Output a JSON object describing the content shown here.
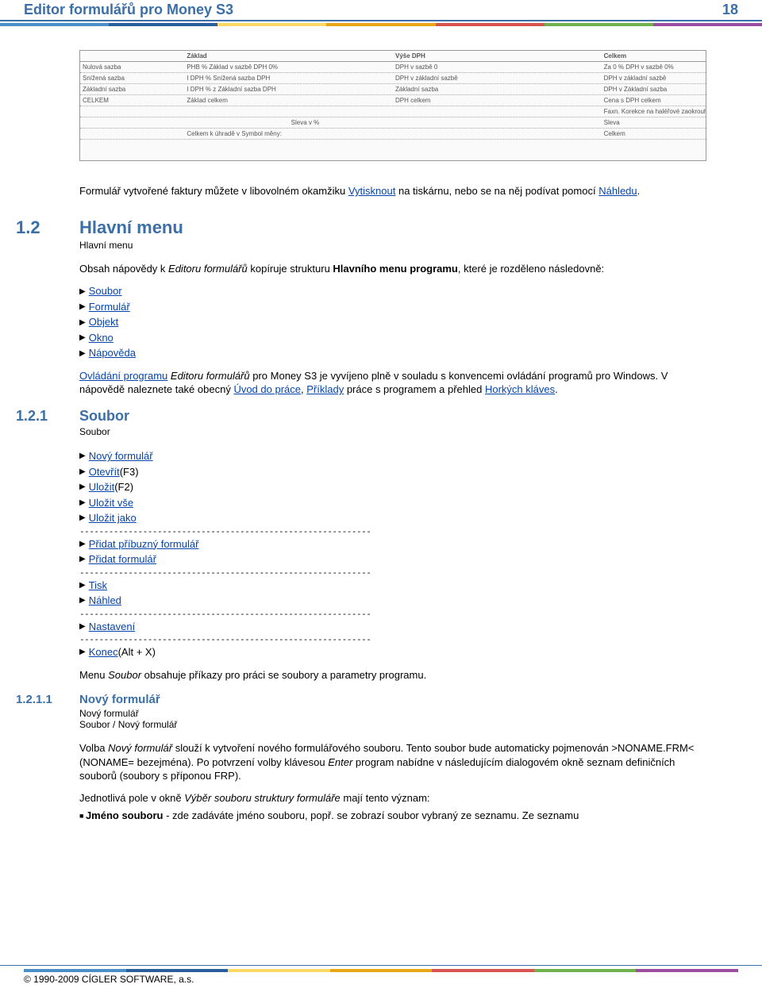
{
  "header": {
    "title": "Editor formulářů pro Money S3",
    "page": "18"
  },
  "screenshot": {
    "head": [
      "",
      "Základ",
      "",
      "Výše DPH",
      "",
      "Celkem"
    ],
    "rows": [
      [
        "Nulová sazba",
        "PHB % Základ v sazbě DPH 0%",
        "",
        "DPH v sazbě 0",
        "",
        "Za 0 % DPH v sazbě 0%"
      ],
      [
        "Snížená sazba",
        "I DPH % Snížená sazba DPH",
        "",
        "DPH v základní sazbě",
        "",
        "DPH v základní sazbě"
      ],
      [
        "Základní sazba",
        "I DPH % z Základní sazba DPH",
        "",
        "Základní sazba",
        "",
        "DPH v Základní sazba"
      ],
      [
        "CELKEM",
        "Základ celkem",
        "",
        "DPH celkem",
        "",
        "Cena s DPH celkem"
      ],
      [
        "",
        "",
        "",
        "",
        "",
        "Faxn. Korekce na haléřové zaokrouh."
      ],
      [
        "",
        "",
        "Sleva v %",
        "",
        "",
        "Sleva"
      ],
      [
        "",
        "Celkem k úhradě v Symbol měny:",
        "",
        "",
        "",
        "Celkem"
      ]
    ]
  },
  "intro": {
    "pre": "Formulář vytvořené faktury můžete v libovolném okamžiku ",
    "link1": "Vytisknout",
    "mid": " na tiskárnu, nebo se na něj podívat pomocí ",
    "link2": "Náhledu",
    "post": "."
  },
  "s12": {
    "num": "1.2",
    "title": "Hlavní menu",
    "sub": "Hlavní menu",
    "para": {
      "t1": "Obsah nápovědy k ",
      "it1": "Editoru formulářů",
      "t2": " kopíruje strukturu ",
      "b1": "Hlavního menu programu",
      "t3": ", které je rozděleno následovně:"
    },
    "items": [
      {
        "label": "Soubor"
      },
      {
        "label": "Formulář"
      },
      {
        "label": "Objekt"
      },
      {
        "label": "Okno"
      },
      {
        "label": "Nápověda"
      }
    ],
    "para2": {
      "l1": "Ovládání programu",
      "t1": " ",
      "it1": "Editoru formulářů",
      "t2": " pro Money S3 je vyvíjeno plně v souladu s konvencemi ovládání programů pro Windows. V nápovědě naleznete také obecný ",
      "l2": "Úvod do práce",
      "t3": ", ",
      "l3": "Příklady",
      "t4": " práce s programem a přehled ",
      "l4": "Horkých kláves",
      "t5": "."
    }
  },
  "s121": {
    "num": "1.2.1",
    "title": "Soubor",
    "sub": "Soubor",
    "items": [
      {
        "type": "item",
        "label": "Nový formulář",
        "suffix": ""
      },
      {
        "type": "item",
        "label": "Otevřít",
        "suffix": " (F3)"
      },
      {
        "type": "item",
        "label": "Uložit",
        "suffix": " (F2)"
      },
      {
        "type": "item",
        "label": "Uložit vše",
        "suffix": ""
      },
      {
        "type": "item",
        "label": "Uložit jako",
        "suffix": ""
      },
      {
        "type": "sep"
      },
      {
        "type": "item",
        "label": "Přidat příbuzný formulář",
        "suffix": ""
      },
      {
        "type": "item",
        "label": "Přidat formulář",
        "suffix": ""
      },
      {
        "type": "sep"
      },
      {
        "type": "item",
        "label": "Tisk",
        "suffix": ""
      },
      {
        "type": "item",
        "label": "Náhled",
        "suffix": ""
      },
      {
        "type": "sep"
      },
      {
        "type": "item",
        "label": "Nastavení",
        "suffix": ""
      },
      {
        "type": "sep"
      },
      {
        "type": "item",
        "label": "Konec",
        "suffix": " (Alt + X)"
      }
    ],
    "desc": {
      "t1": "Menu ",
      "it1": "Soubor",
      "t2": " obsahuje příkazy pro práci se soubory a parametry programu."
    }
  },
  "s1211": {
    "num": "1.2.1.1",
    "title": "Nový formulář",
    "sub1": "Nový formulář",
    "sub2": "Soubor / Nový formulář",
    "para1": {
      "t1": "Volba ",
      "it1": "Nový formulář",
      "t2": " slouží k vytvoření nového formulářového souboru. Tento soubor bude automaticky pojmenován >NONAME.FRM< (NONAME= bezejména). Po potvrzení volby klávesou ",
      "it2": "Enter",
      "t3": " program nabídne v následujícím dialogovém okně seznam definičních souborů (soubory s příponou FRP)."
    },
    "para2": {
      "t1": "Jednotlivá pole v okně ",
      "it1": "Výběr souboru struktury formuláře",
      "t2": " mají tento význam:"
    },
    "bullet": {
      "b1": "Jméno souboru",
      "t1": " - zde zadáváte jméno souboru, popř. se zobrazí soubor vybraný ze seznamu. Ze seznamu"
    }
  },
  "footer": {
    "text": "© 1990-2009 CÍGLER SOFTWARE, a.s."
  }
}
